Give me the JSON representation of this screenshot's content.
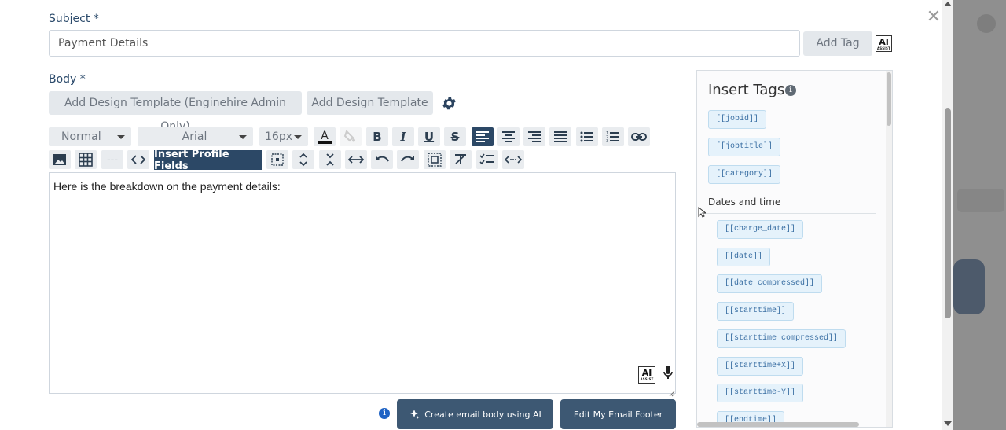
{
  "subject": {
    "label": "Subject *",
    "value": "Payment Details",
    "add_tag_label": "Add Tag"
  },
  "ai_badge": {
    "line1": "AI",
    "line2": "ASSIST"
  },
  "body": {
    "label": "Body *",
    "add_design_template_admin": "Add Design Template (Enginehire Admin Only)",
    "add_design_template": "Add Design Template"
  },
  "toolbar": {
    "paragraph_style": "Normal",
    "font_family": "Arial",
    "font_size": "16px",
    "hr_label": "---",
    "insert_profile_fields": "Insert Profile Fields"
  },
  "editor": {
    "content": "Here is the breakdown on the payment details:"
  },
  "footer": {
    "create_email_body_label": "Create email body using AI",
    "edit_footer_label": "Edit My Email Footer"
  },
  "tags_panel": {
    "title": "Insert Tags",
    "general_tags": [
      "[[jobid]]",
      "[[jobtitle]]",
      "[[category]]"
    ],
    "section_title": "Dates and time",
    "date_tags": [
      "[[charge_date]]",
      "[[date]]",
      "[[date_compressed]]",
      "[[starttime]]",
      "[[starttime_compressed]]",
      "[[starttime+X]]",
      "[[starttime-Y]]",
      "[[endtime]]"
    ]
  },
  "colors": {
    "label_blue": "#2b4a6b",
    "toolbar_active": "#2c4866",
    "button_dark": "#3d5873",
    "tag_bg": "#e5f2fb",
    "tag_text": "#3a6fa3",
    "info_blue": "#1e62c4"
  }
}
